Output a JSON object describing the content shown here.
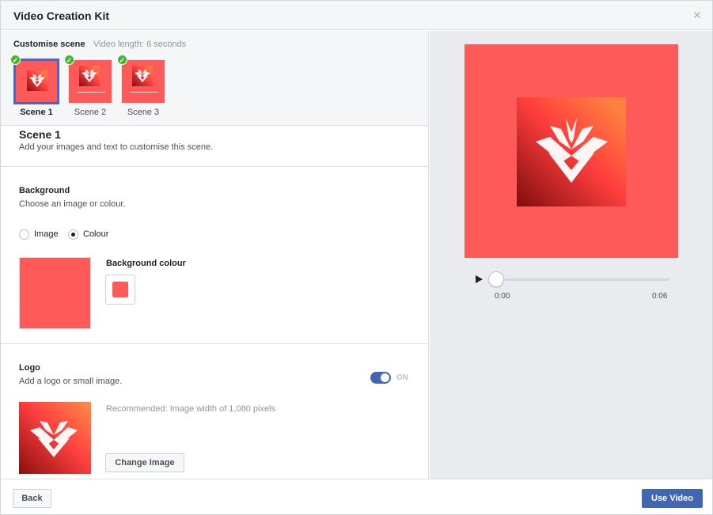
{
  "dialog": {
    "title": "Video Creation Kit"
  },
  "scenes_panel": {
    "title": "Customise scene",
    "video_length": "Video length: 6 seconds",
    "scenes": [
      {
        "label": "Scene 1"
      },
      {
        "label": "Scene 2"
      },
      {
        "label": "Scene 3"
      }
    ]
  },
  "scene_info": {
    "title": "Scene 1",
    "description": "Add your images and text to customise this scene."
  },
  "background": {
    "title": "Background",
    "description": "Choose an image or colour.",
    "option_image": "Image",
    "option_colour": "Colour",
    "colour_label": "Background colour",
    "colour_value": "#ff5a5a"
  },
  "logo": {
    "title": "Logo",
    "description": "Add a logo or small image.",
    "toggle_label": "ON",
    "recommendation": "Recommended: Image width of 1,080 pixels",
    "change_button": "Change Image"
  },
  "player": {
    "current_time": "0:00",
    "duration": "0:06",
    "progress": 0
  },
  "footer": {
    "back_label": "Back",
    "use_label": "Use Video"
  },
  "colors": {
    "accent": "#4267b2",
    "background_red": "#ff5a5a",
    "check_green": "#42b72a"
  }
}
